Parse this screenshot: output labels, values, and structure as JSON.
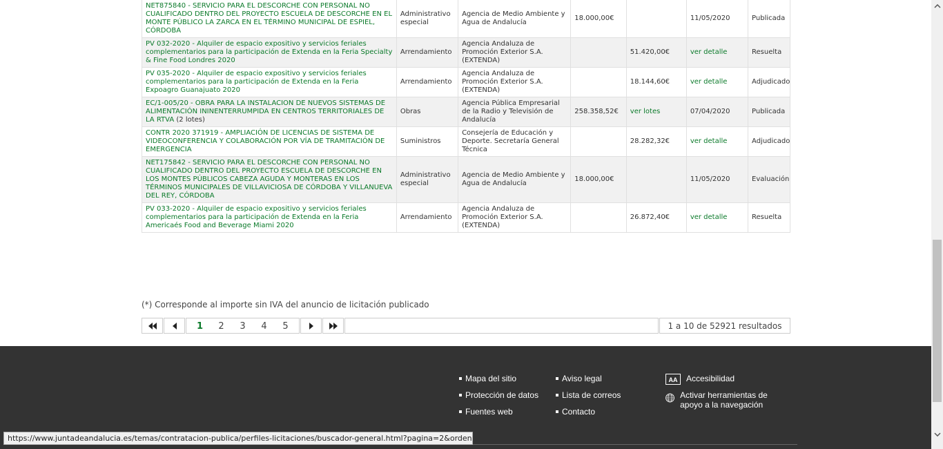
{
  "rows": [
    {
      "title": "NET875840 - SERVICIO PARA EL DESCORCHE CON PERSONAL NO CUALIFICADO DENTRO DEL PROYECTO ESCUELA DE DESCORCHE EN EL MONTE PÚBLICO LA ZARCA EN EL TÉRMINO MUNICIPAL DE ESPIEL, CÓRDOBA",
      "lots": "",
      "type": "Administrativo especial",
      "entity": "Agencia de Medio Ambiente y Agua de Andalucía",
      "amount": "18.000,00€",
      "awarded": "",
      "date": "11/05/2020",
      "date_link": false,
      "status": "Publicada"
    },
    {
      "title": "PV 032-2020 - Alquiler de espacio expositivo y servicios feriales complementarios para la participación de Extenda en la Feria Specialty & Fine Food Londres 2020",
      "lots": "",
      "type": "Arrendamiento",
      "entity": "Agencia Andaluza de Promoción Exterior S.A. (EXTENDA)",
      "amount": "",
      "awarded": "51.420,00€",
      "date": "ver detalle",
      "date_link": true,
      "status": "Resuelta"
    },
    {
      "title": "PV 035-2020 - Alquiler de espacio expositivo y servicios feriales complementarios para la participación de Extenda en la Feria Expoagro Guanajuato 2020",
      "lots": "",
      "type": "Arrendamiento",
      "entity": "Agencia Andaluza de Promoción Exterior S.A. (EXTENDA)",
      "amount": "",
      "awarded": "18.144,60€",
      "date": "ver detalle",
      "date_link": true,
      "status": "Adjudicado"
    },
    {
      "title": "EC/1-005/20 - OBRA PARA LA INSTALACION DE NUEVOS SISTEMAS DE ALIMENTACIÓN ININENTERRUMPIDA EN CENTROS TERRITORIALES DE LA RTVA",
      "lots": "(2 lotes)",
      "type": "Obras",
      "entity": "Agencia Pública Empresarial de la Radio y Televisión de Andalucía",
      "amount": "258.358,52€",
      "awarded": "ver lotes",
      "date": "07/04/2020",
      "date_link": false,
      "status": "Publicada"
    },
    {
      "title": "CONTR 2020 371919 - AMPLIACIÓN DE LICENCIAS DE SISTEMA DE VIDEOCONFERENCIA Y COLABORACIÓN POR VÍA DE TRAMITACIÓN DE EMERGENCIA",
      "lots": "",
      "type": "Suministros",
      "entity": "Consejería de Educación y Deporte. Secretaría General Técnica",
      "amount": "",
      "awarded": "28.282,32€",
      "date": "ver detalle",
      "date_link": true,
      "status": "Adjudicado"
    },
    {
      "title": "NET175842 - SERVICIO PARA EL DESCORCHE CON PERSONAL NO CUALIFICADO DENTRO DEL PROYECTO ESCUELA DE DESCORCHE EN LOS MONTES PÚBLICOS CABEZA AGUDA Y MONTERAS EN LOS TÉRMINOS MUNICIPALES DE VILLAVICIOSA DE CÓRDOBA Y VILLANUEVA DEL REY, CÓRDOBA",
      "lots": "",
      "type": "Administrativo especial",
      "entity": "Agencia de Medio Ambiente y Agua de Andalucía",
      "amount": "18.000,00€",
      "awarded": "",
      "date": "11/05/2020",
      "date_link": false,
      "status": "Evaluación"
    },
    {
      "title": "PV 033-2020 - Alquiler de espacio expositivo y servicios feriales complementarios para la participación de Extenda en la Feria Americaés Food and Beverage Miami 2020",
      "lots": "",
      "type": "Arrendamiento",
      "entity": "Agencia Andaluza de Promoción Exterior S.A. (EXTENDA)",
      "amount": "",
      "awarded": "26.872,40€",
      "date": "ver detalle",
      "date_link": true,
      "status": "Resuelta"
    }
  ],
  "note": "(*) Corresponde al importe sin IVA del anuncio de licitación publicado",
  "pagination": {
    "first_icon": "first-page-icon",
    "prev_icon": "prev-page-icon",
    "next_icon": "next-page-icon",
    "last_icon": "last-page-icon",
    "pages": [
      "1",
      "2",
      "3",
      "4",
      "5"
    ],
    "current": "1",
    "results": "1 a 10 de 52921 resultados"
  },
  "footer": {
    "col1": [
      "Mapa del sitio",
      "Protección de datos",
      "Fuentes web"
    ],
    "col2": [
      "Aviso legal",
      "Lista de correos",
      "Contacto"
    ],
    "accessibility": "Accesibilidad",
    "tools": "Activar herramientas de apoyo a la navegación",
    "acc_icon_text": "AA"
  },
  "status_url": "https://www.juntadeandalucia.es/temas/contratacion-publica/perfiles-licitaciones/buscador-general.html?pagina=2&orden...",
  "colors": {
    "link": "#0b7a2a",
    "footer_bg": "#333333"
  }
}
